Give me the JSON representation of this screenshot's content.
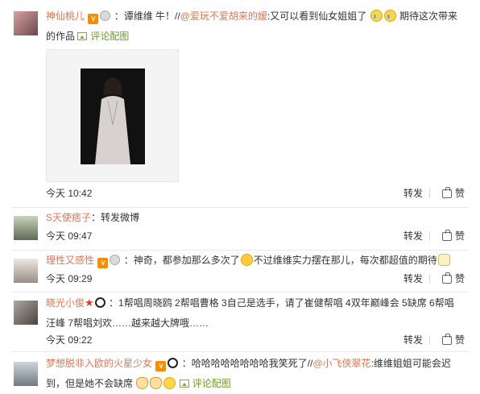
{
  "comments": [
    {
      "user": "神仙桃儿",
      "text_before": "：谭维维 牛！//",
      "mention": "@爱玩不爱胡来的嫒",
      "text_after": ":又可以看到仙女姐姐了",
      "text_after2": " 期待这次带来",
      "line2": "的作品",
      "pic_label": "评论配图",
      "time": "今天 10:42",
      "repost": "转发",
      "like": "赞"
    },
    {
      "user": "S天使痞子",
      "text": "：转发微博",
      "time": "今天 09:47",
      "repost": "转发",
      "like": "赞"
    },
    {
      "user": "理性又感性",
      "text": "：神奇，都参加那么多次了",
      "text_after": "不过维维实力摆在那儿，每次都超值的期待",
      "time": "今天 09:29",
      "repost": "转发",
      "like": "赞"
    },
    {
      "user": "晓光小俊",
      "text": "：1帮唱周晓鸥 2帮唱曹格 3自己是选手，请了崔健帮唱 4双年巅峰会 5缺席 6帮唱",
      "line2": "汪峰 7帮唱刘欢……越来越大牌哦……",
      "time": "今天 09:22",
      "repost": "转发",
      "like": "赞"
    },
    {
      "user": "梦想脱非入欧的火星少女",
      "text_before": "：哈哈哈哈哈哈哈哈我笑死了//",
      "mention": "@小飞侠翠花",
      "text_after": ":维维姐姐可能会迟",
      "line2": "到，但是她不会缺席",
      "pic_label": "评论配图"
    }
  ],
  "colors": {
    "username": "#eb7350",
    "pic_link": "#6b9d1c",
    "separator": "#eaeaea"
  },
  "icons": [
    "vip-badge-icon",
    "medal-icon",
    "panda-icon",
    "star-icon",
    "cry-emoji-icon",
    "laugh-emoji-icon",
    "hand-emoji-icon",
    "cat-emoji-icon",
    "picture-icon",
    "thumbs-up-icon"
  ]
}
